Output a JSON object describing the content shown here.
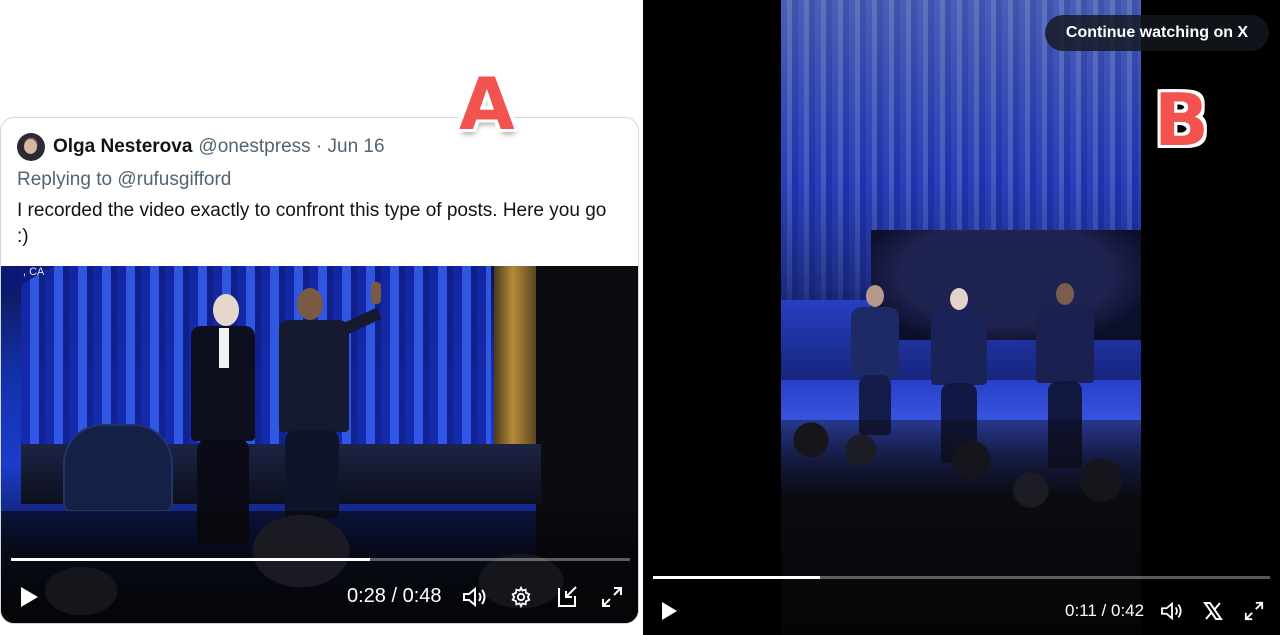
{
  "panel_a": {
    "marker": "A",
    "tweet": {
      "author_name": "Olga Nesterova",
      "author_meta": "@onestpress · Jun 16",
      "reply_prefix": "Replying to",
      "reply_handle": "@rufusgifford",
      "text": "I recorded the video exactly to confront this type of posts. Here you go :)"
    },
    "video": {
      "location_label": ", CA",
      "time": "0:28 / 0:48",
      "progress": 0.58,
      "controls": [
        "play-icon",
        "volume-icon",
        "gear-icon",
        "pip-icon",
        "fullscreen-icon"
      ]
    }
  },
  "panel_b": {
    "marker": "B",
    "continue_label": "Continue watching on X",
    "video": {
      "time": "0:11 / 0:42",
      "progress": 0.27,
      "controls": [
        "play-icon",
        "volume-icon",
        "x-logo-icon",
        "fullscreen-icon"
      ]
    }
  },
  "colors": {
    "marker_red": "#f2534f",
    "text_primary": "#0f1419",
    "text_secondary": "#536471",
    "card_border": "#cfd9de",
    "stage_blue": "#1b3ccc"
  }
}
